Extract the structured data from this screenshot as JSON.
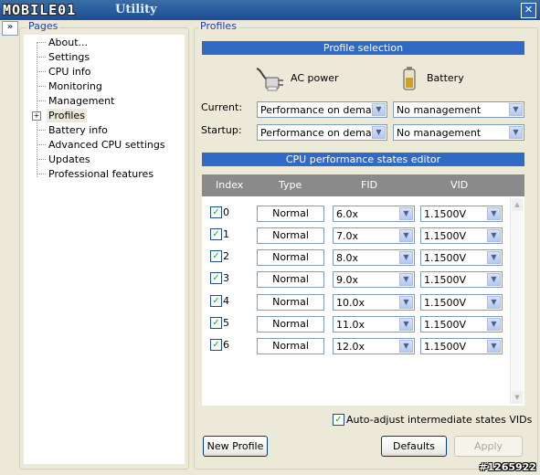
{
  "window": {
    "logo": "MOBILE01",
    "title": "Utility",
    "close_icon": "close-icon"
  },
  "pages": {
    "label": "Pages",
    "items": [
      {
        "label": "About..."
      },
      {
        "label": "Settings"
      },
      {
        "label": "CPU info"
      },
      {
        "label": "Monitoring"
      },
      {
        "label": "Management"
      },
      {
        "label": "Profiles",
        "selected": true,
        "expandable": true
      },
      {
        "label": "Battery info"
      },
      {
        "label": "Advanced CPU settings"
      },
      {
        "label": "Updates"
      },
      {
        "label": "Professional features"
      }
    ]
  },
  "profiles": {
    "label": "Profiles",
    "selection_header": "Profile selection",
    "ac_power_label": "AC power",
    "battery_label": "Battery",
    "current_label": "Current:",
    "startup_label": "Startup:",
    "current_ac": "Performance on demand",
    "current_battery": "No management",
    "startup_ac": "Performance on demand",
    "startup_battery": "No management",
    "editor_header": "CPU performance states editor",
    "columns": {
      "index": "Index",
      "type": "Type",
      "fid": "FID",
      "vid": "VID"
    },
    "states": [
      {
        "index": "0",
        "type": "Normal",
        "fid": "6.0x",
        "vid": "1.1500V",
        "checked": true
      },
      {
        "index": "1",
        "type": "Normal",
        "fid": "7.0x",
        "vid": "1.1500V",
        "checked": true
      },
      {
        "index": "2",
        "type": "Normal",
        "fid": "8.0x",
        "vid": "1.1500V",
        "checked": true
      },
      {
        "index": "3",
        "type": "Normal",
        "fid": "9.0x",
        "vid": "1.1500V",
        "checked": true
      },
      {
        "index": "4",
        "type": "Normal",
        "fid": "10.0x",
        "vid": "1.1500V",
        "checked": true
      },
      {
        "index": "5",
        "type": "Normal",
        "fid": "11.0x",
        "vid": "1.1500V",
        "checked": true
      },
      {
        "index": "6",
        "type": "Normal",
        "fid": "12.0x",
        "vid": "1.1500V",
        "checked": true
      }
    ],
    "auto_adjust_label": "Auto-adjust intermediate states VIDs",
    "auto_adjust_checked": true,
    "new_profile_label": "New Profile",
    "defaults_label": "Defaults",
    "apply_label": "Apply"
  },
  "watermark": "#1265922",
  "colors": {
    "title_bar": "#2a5fa0",
    "section_band": "#316ac5",
    "table_header": "#8a8a8a",
    "window_bg": "#ece9d8"
  }
}
